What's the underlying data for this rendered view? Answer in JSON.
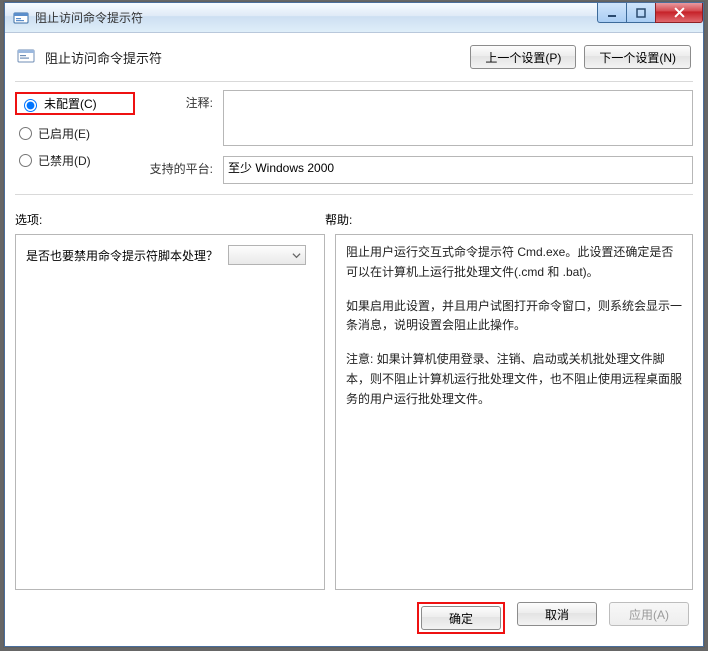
{
  "window": {
    "title": "阻止访问命令提示符"
  },
  "header": {
    "policy_title": "阻止访问命令提示符",
    "prev_setting": "上一个设置(P)",
    "next_setting": "下一个设置(N)"
  },
  "state": {
    "not_configured": "未配置(C)",
    "enabled": "已启用(E)",
    "disabled": "已禁用(D)"
  },
  "labels": {
    "comment": "注释:",
    "supported": "支持的平台:",
    "options": "选项:",
    "help": "帮助:"
  },
  "fields": {
    "comment_value": "",
    "supported_value": "至少 Windows 2000"
  },
  "options": {
    "script_prompt": "是否也要禁用命令提示符脚本处理？"
  },
  "help": {
    "p1": "阻止用户运行交互式命令提示符 Cmd.exe。此设置还确定是否可以在计算机上运行批处理文件(.cmd 和 .bat)。",
    "p2": "如果启用此设置，并且用户试图打开命令窗口，则系统会显示一条消息，说明设置会阻止此操作。",
    "p3": "注意: 如果计算机使用登录、注销、启动或关机批处理文件脚本，则不阻止计算机运行批处理文件，也不阻止使用远程桌面服务的用户运行批处理文件。"
  },
  "footer": {
    "ok": "确定",
    "cancel": "取消",
    "apply": "应用(A)"
  }
}
